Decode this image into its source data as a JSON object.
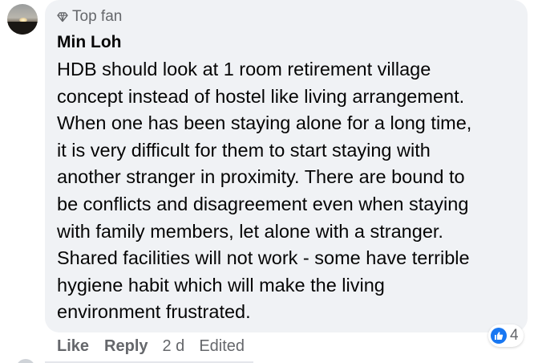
{
  "comment": {
    "badge_label": "Top fan",
    "badge_icon": "diamond-icon",
    "author": "Min Loh",
    "text_lines": [
      "HDB should look at 1 room retirement village",
      "concept instead of hostel like living arrangement.",
      "When one has been staying alone for a long time,",
      "it is very difficult for them to start staying with",
      "another stranger in proximity. There are bound to",
      "be conflicts and disagreement even when staying",
      "with family members, let alone with a stranger.",
      "Shared facilities will not work - some have terrible",
      "hygiene habit which will make the living",
      "environment frustrated."
    ],
    "reactions": {
      "icon": "thumbs-up-icon",
      "count": "4"
    },
    "actions": {
      "like_label": "Like",
      "reply_label": "Reply",
      "time": "2 d",
      "edited_label": "Edited"
    }
  },
  "colors": {
    "bubble_bg": "#f0f2f5",
    "text": "#050505",
    "meta": "#65676b",
    "like_blue": "#1877f2"
  }
}
